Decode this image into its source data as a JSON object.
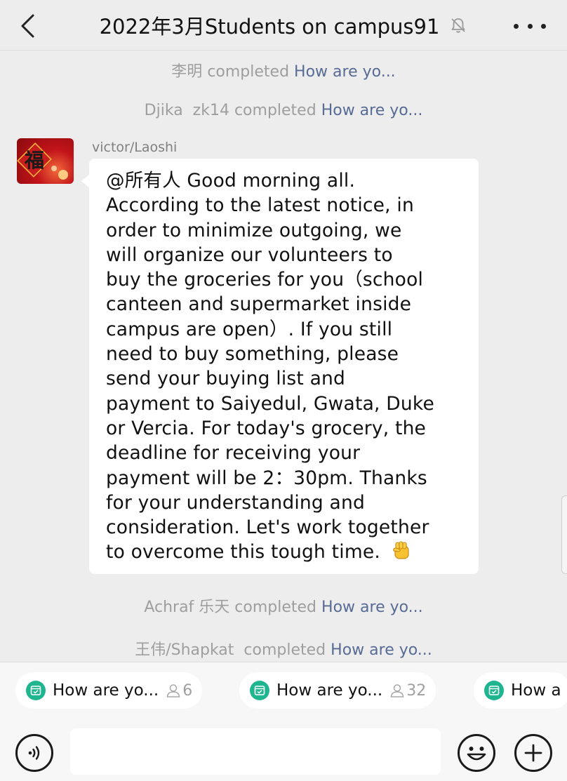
{
  "header": {
    "back_icon": "chevron-left-icon",
    "title": "2022年3月Students on campus91",
    "mute_icon": "bell-muted-icon",
    "more_icon": "more-horizontal-icon"
  },
  "notices": [
    {
      "name": "李明",
      "action": "completed",
      "link": "How are yo..."
    },
    {
      "name": "Djika  zk14",
      "action": "completed",
      "link": "How are yo..."
    }
  ],
  "message": {
    "sender": "victor/Laoshi",
    "avatar": "fu-character-avatar",
    "lines": [
      "@所有人  Good morning all.",
      "According to the latest notice, in",
      "order to minimize outgoing, we",
      "will organize our volunteers to",
      "buy the groceries for you（school",
      "canteen and supermarket inside",
      "campus are open）. If you still",
      "need to buy something, please",
      "send your buying list and",
      "payment to Saiyedul, Gwata, Duke",
      "or Vercia. For today's grocery, the",
      "deadline for receiving your",
      "payment will be 2：30pm. Thanks",
      "for your understanding and",
      "consideration. Let's work together",
      "to overcome this tough time."
    ],
    "end_emoji": "raised-fist-emoji"
  },
  "notices_after": [
    {
      "name": "Achraf 乐天",
      "action": "completed",
      "link": "How are yo..."
    },
    {
      "name": "王伟/Shapkat ",
      "action": "completed",
      "link": "How are yo..."
    }
  ],
  "chips": [
    {
      "label": "How are yo...",
      "count": "6"
    },
    {
      "label": "How are yo...",
      "count": "32"
    },
    {
      "label": "How a",
      "count": ""
    }
  ],
  "input_bar": {
    "voice_icon": "voice-icon",
    "text_value": "",
    "emoji_icon": "smiley-icon",
    "plus_icon": "plus-icon"
  },
  "colors": {
    "background": "#ededed",
    "bubble": "#ffffff",
    "link": "#576b95",
    "notice_text": "#9e9e9e",
    "chip_icon": "#1fb58f"
  }
}
